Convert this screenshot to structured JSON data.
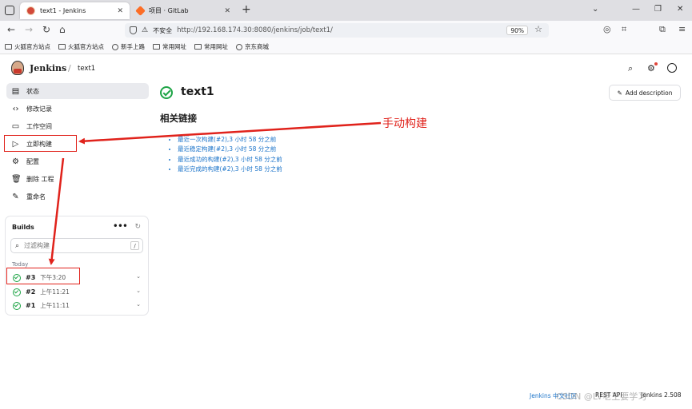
{
  "browser": {
    "tabs": [
      {
        "title": "text1 - Jenkins",
        "active": true
      },
      {
        "title": "项目 · GitLab",
        "active": false
      }
    ],
    "new_tab": "+",
    "security": "不安全",
    "url": "http://192.168.174.30:8080/jenkins/job/text1/",
    "zoom": "90%",
    "bookmarks": [
      "火狐官方站点",
      "火狐官方站点",
      "新手上路",
      "常用网址",
      "常用网址",
      "京东商城"
    ]
  },
  "header": {
    "brand": "Jenkins",
    "separator": "/",
    "breadcrumb": "text1"
  },
  "sidebar": {
    "items": [
      {
        "label": "状态",
        "icon": "document-icon"
      },
      {
        "label": "修改记录",
        "icon": "code-icon"
      },
      {
        "label": "工作空间",
        "icon": "folder-icon"
      },
      {
        "label": "立即构建",
        "icon": "play-icon"
      },
      {
        "label": "配置",
        "icon": "gear-icon"
      },
      {
        "label": "删除 工程",
        "icon": "trash-icon"
      },
      {
        "label": "重命名",
        "icon": "pencil-icon"
      }
    ]
  },
  "builds": {
    "title": "Builds",
    "filter_placeholder": "过滤构建",
    "shortcut": "/",
    "group": "Today",
    "rows": [
      {
        "number": "#3",
        "time": "下午3:20",
        "status": "success"
      },
      {
        "number": "#2",
        "time": "上午11:21",
        "status": "success"
      },
      {
        "number": "#1",
        "time": "上午11:11",
        "status": "success"
      }
    ]
  },
  "main": {
    "job_title": "text1",
    "add_description": "Add description",
    "related_title": "相关链接",
    "links": [
      "最近一次构建(#2),3 小时 58 分之前",
      "最近稳定构建(#2),3 小时 58 分之前",
      "最近成功的构建(#2),3 小时 58 分之前",
      "最近完成的构建(#2),3 小时 58 分之前"
    ]
  },
  "annotation": {
    "label": "手动构建",
    "color": "#e0221b"
  },
  "footer": {
    "community": "Jenkins 中文社区",
    "rest_api": "REST API",
    "version": "Jenkins 2.508"
  },
  "watermark": "CSDN @LV老王要学习",
  "colors": {
    "success": "#1ea446",
    "link": "#1a73c9",
    "active_bg": "#e9eaee"
  }
}
